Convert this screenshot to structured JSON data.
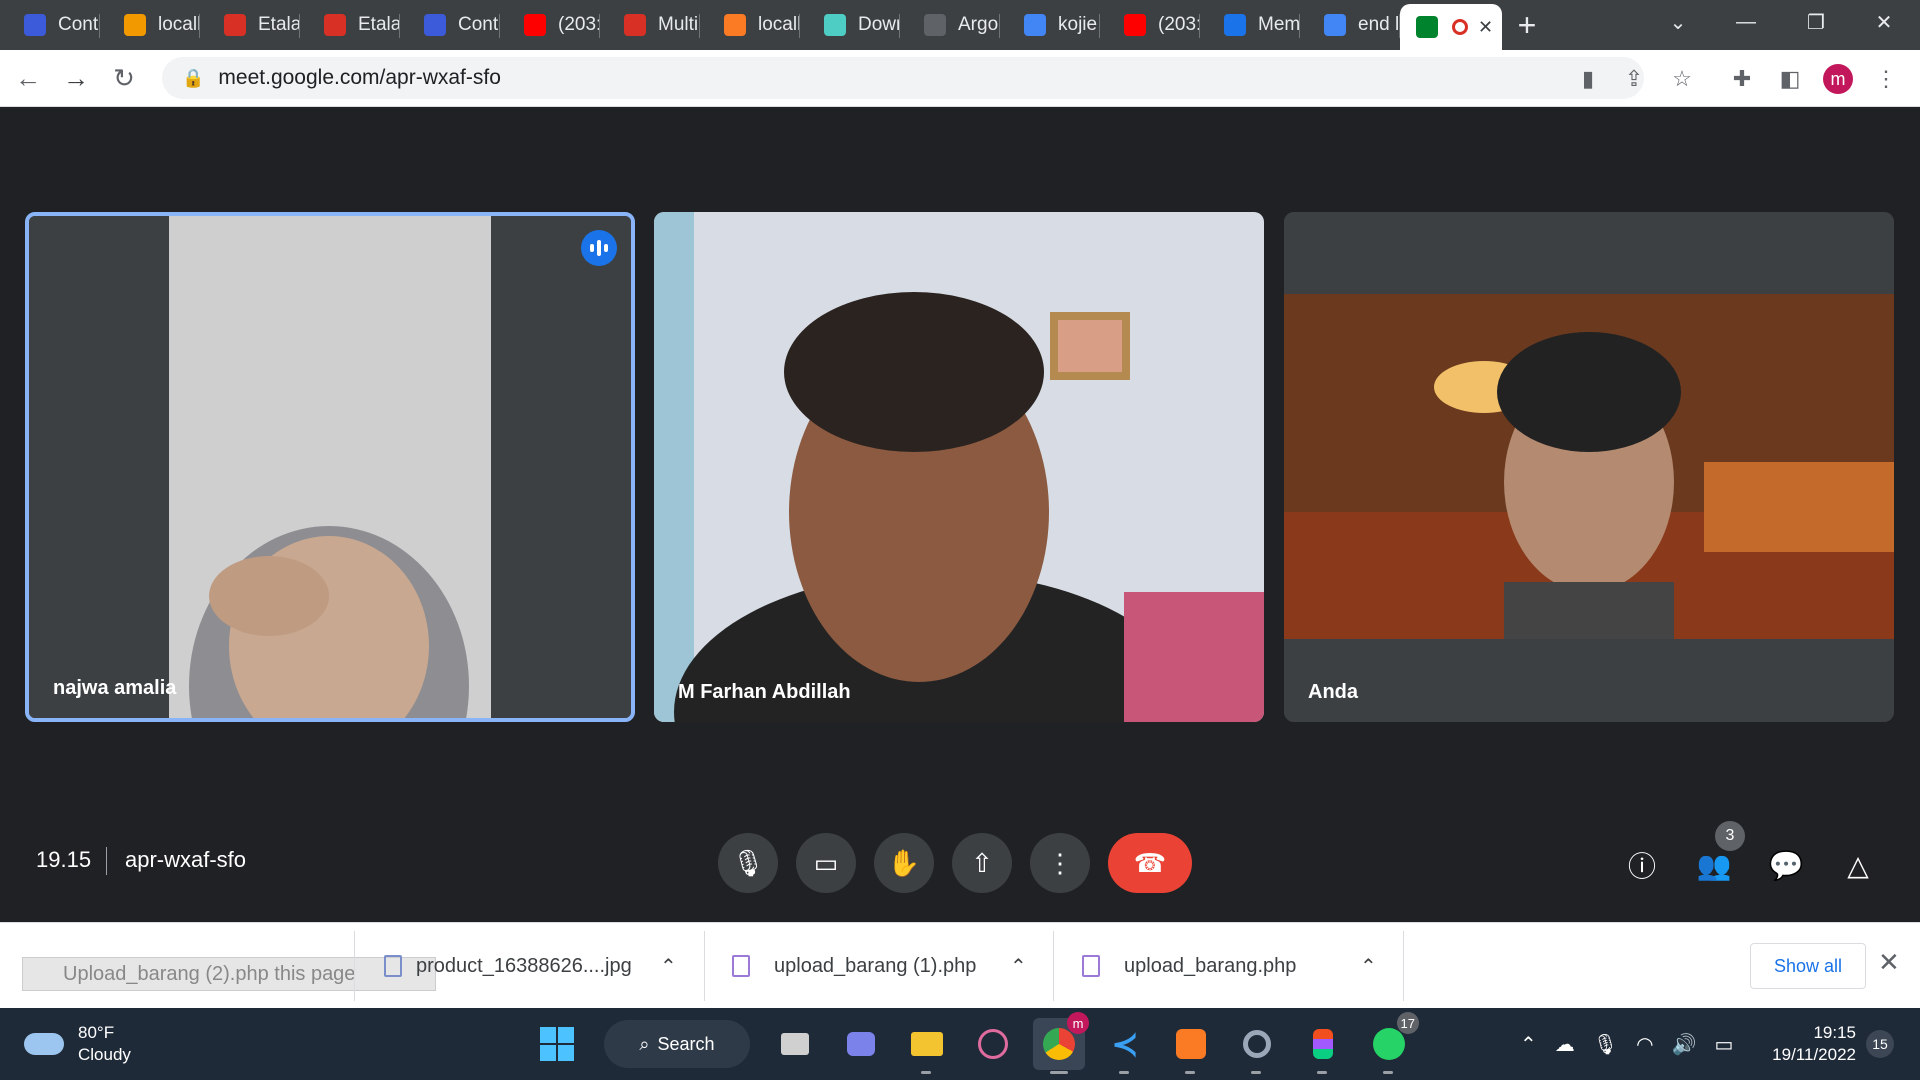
{
  "browser": {
    "tabs": [
      {
        "title": "Cont",
        "icon": "blackbox-icon",
        "color": "#3b5bdb"
      },
      {
        "title": "locall",
        "icon": "tent-icon",
        "color": "#f29900"
      },
      {
        "title": "Etala",
        "icon": "etalase-icon",
        "color": "#d93025"
      },
      {
        "title": "Etala",
        "icon": "etalase-icon",
        "color": "#d93025"
      },
      {
        "title": "Conti",
        "icon": "blackbox-icon",
        "color": "#3b5bdb"
      },
      {
        "title": "(203:",
        "icon": "youtube-icon",
        "color": "#ff0000"
      },
      {
        "title": "Multi",
        "icon": "laravel-icon",
        "color": "#d93025"
      },
      {
        "title": "locall",
        "icon": "xampp-icon",
        "color": "#fb7a24"
      },
      {
        "title": "Dowr",
        "icon": "download-page-icon",
        "color": "#4ecdc4"
      },
      {
        "title": "Argo",
        "icon": "argo-icon",
        "color": "#5f6368"
      },
      {
        "title": "kojie",
        "icon": "google-icon",
        "color": "#4285f4"
      },
      {
        "title": "(203:",
        "icon": "youtube-icon",
        "color": "#ff0000"
      },
      {
        "title": "Mem",
        "icon": "flutter-icon",
        "color": "#1a73e8"
      },
      {
        "title": "end l",
        "icon": "google-icon",
        "color": "#4285f4"
      },
      {
        "title": "",
        "icon": "meet-icon",
        "color": "#00832d",
        "active": true
      }
    ],
    "url": "meet.google.com/apr-wxaf-sfo",
    "profile_initial": "m"
  },
  "meet": {
    "participants": [
      {
        "name": "najwa amalia",
        "speaking": true
      },
      {
        "name": "M Farhan Abdillah"
      },
      {
        "name": "Anda"
      }
    ],
    "time": "19.15",
    "meeting_code": "apr-wxaf-sfo",
    "people_count": "3"
  },
  "downloads": {
    "drag_text": "Upload_barang (2).php this page",
    "items": [
      {
        "name": "product_16388626....jpg"
      },
      {
        "name": "upload_barang (1).php"
      },
      {
        "name": "upload_barang.php"
      }
    ],
    "show_all": "Show all"
  },
  "taskbar": {
    "temperature": "80°F",
    "condition": "Cloudy",
    "search_label": "Search",
    "chrome_badge": "m",
    "whatsapp_badge": "17",
    "time": "19:15",
    "date": "19/11/2022",
    "notifications": "15"
  }
}
